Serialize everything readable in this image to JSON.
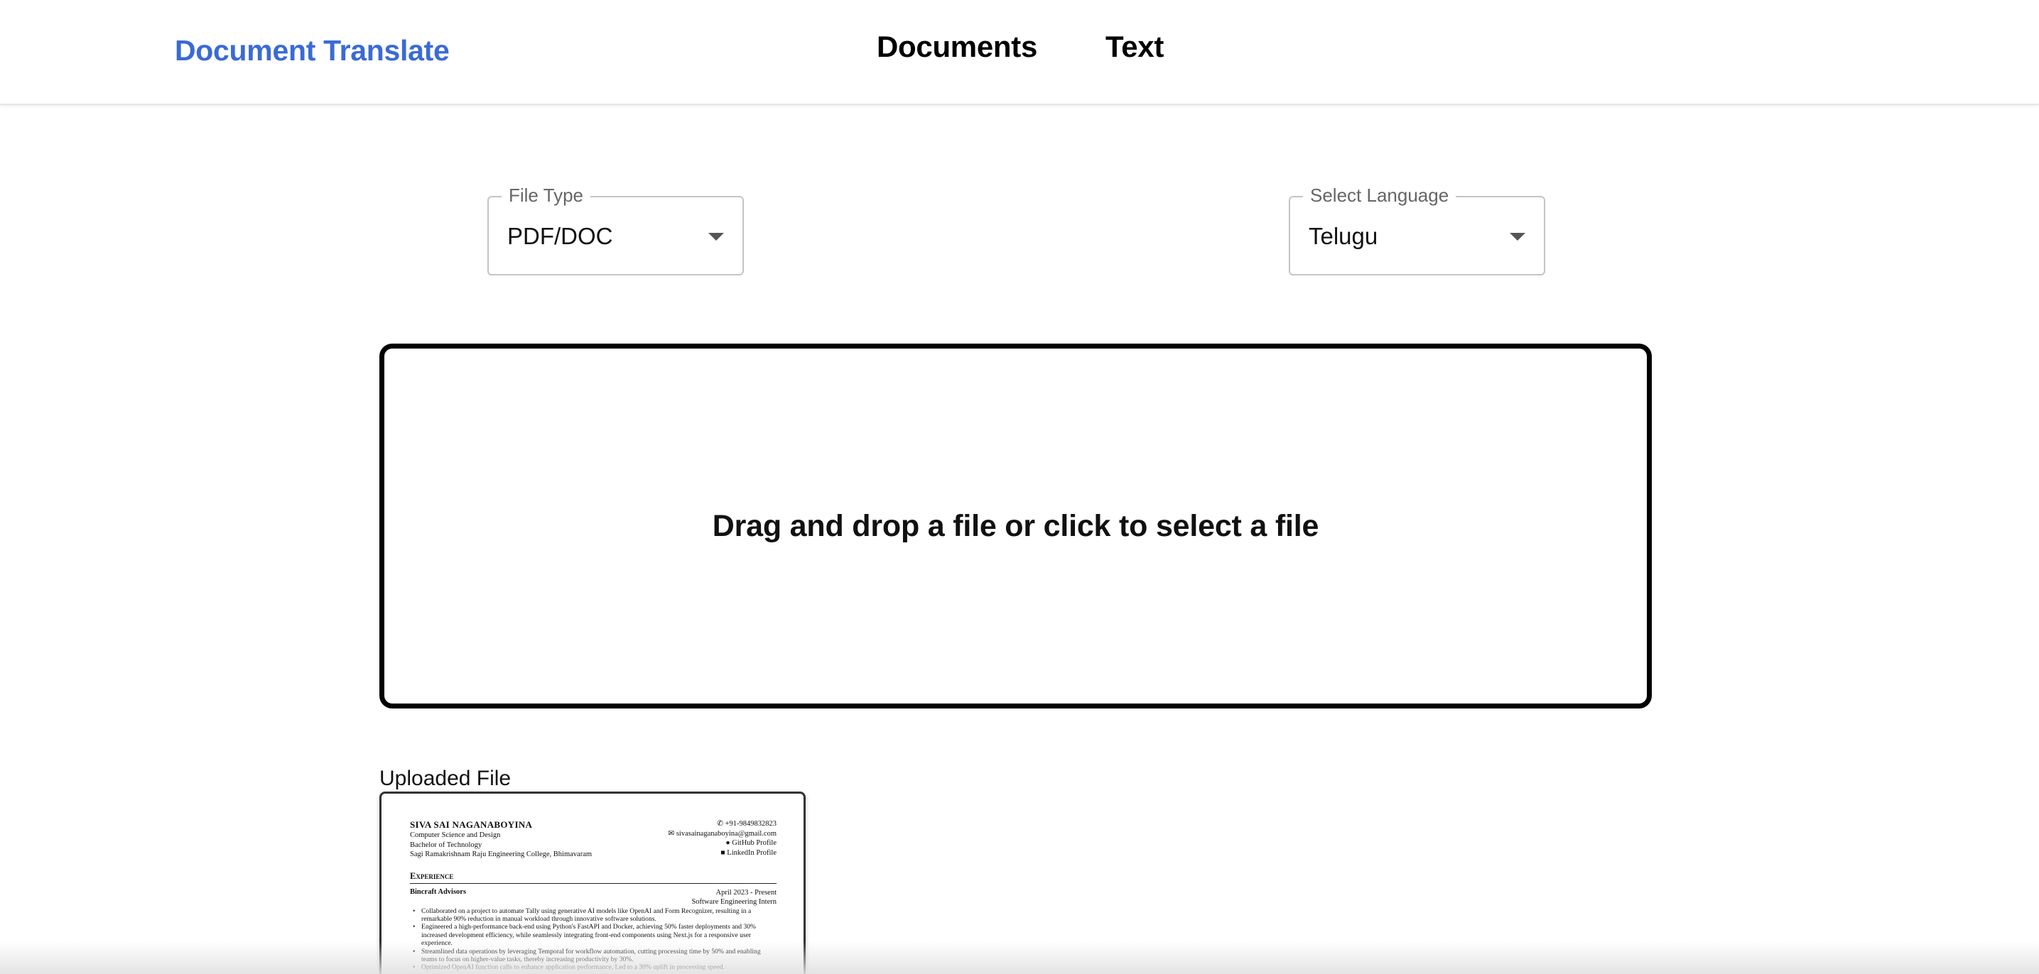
{
  "header": {
    "brand": "Document Translate",
    "nav": [
      {
        "label": "Documents"
      },
      {
        "label": "Text"
      }
    ]
  },
  "controls": {
    "file_type": {
      "label": "File Type",
      "value": "PDF/DOC"
    },
    "language": {
      "label": "Select Language",
      "value": "Telugu"
    }
  },
  "dropzone": {
    "text": "Drag and drop a file or click to select a file"
  },
  "uploaded": {
    "label": "Uploaded File",
    "preview": {
      "name": "SIVA SAI NAGANABOYINA",
      "left_lines": [
        "Computer Science and Design",
        "Bachelor of Technology",
        "Sagi Ramakrishnam Raju Engineering College, Bhimavaram"
      ],
      "right_lines": [
        "+91-9849832823",
        "sivasainaganaboyina@gmail.com",
        "GitHub Profile",
        "LinkedIn Profile"
      ],
      "section": "Experience",
      "company": "Bincraft Advisors",
      "date": "April 2023 - Present",
      "role": "Software Engineering Intern",
      "bullets": [
        "Collaborated on a project to automate Tally using generative AI models like OpenAI and Form Recognizer, resulting in a remarkable 90% reduction in manual workload through innovative software solutions.",
        "Engineered a high-performance back-end using Python's FastAPI and Docker, achieving 50% faster deployments and 30% increased development efficiency, while seamlessly integrating front-end components using Next.js for a responsive user experience.",
        "Streamlined data operations by leveraging Temporal for workflow automation, cutting processing time by 50% and enabling teams to focus on higher-value tasks, thereby increasing productivity by 30%.",
        "Optimized OpenAI function calls to enhance application performance, Led to a 30% uplift in processing speed."
      ]
    }
  },
  "colors": {
    "brand": "#3a6bd4",
    "border": "#c4c4c4"
  }
}
